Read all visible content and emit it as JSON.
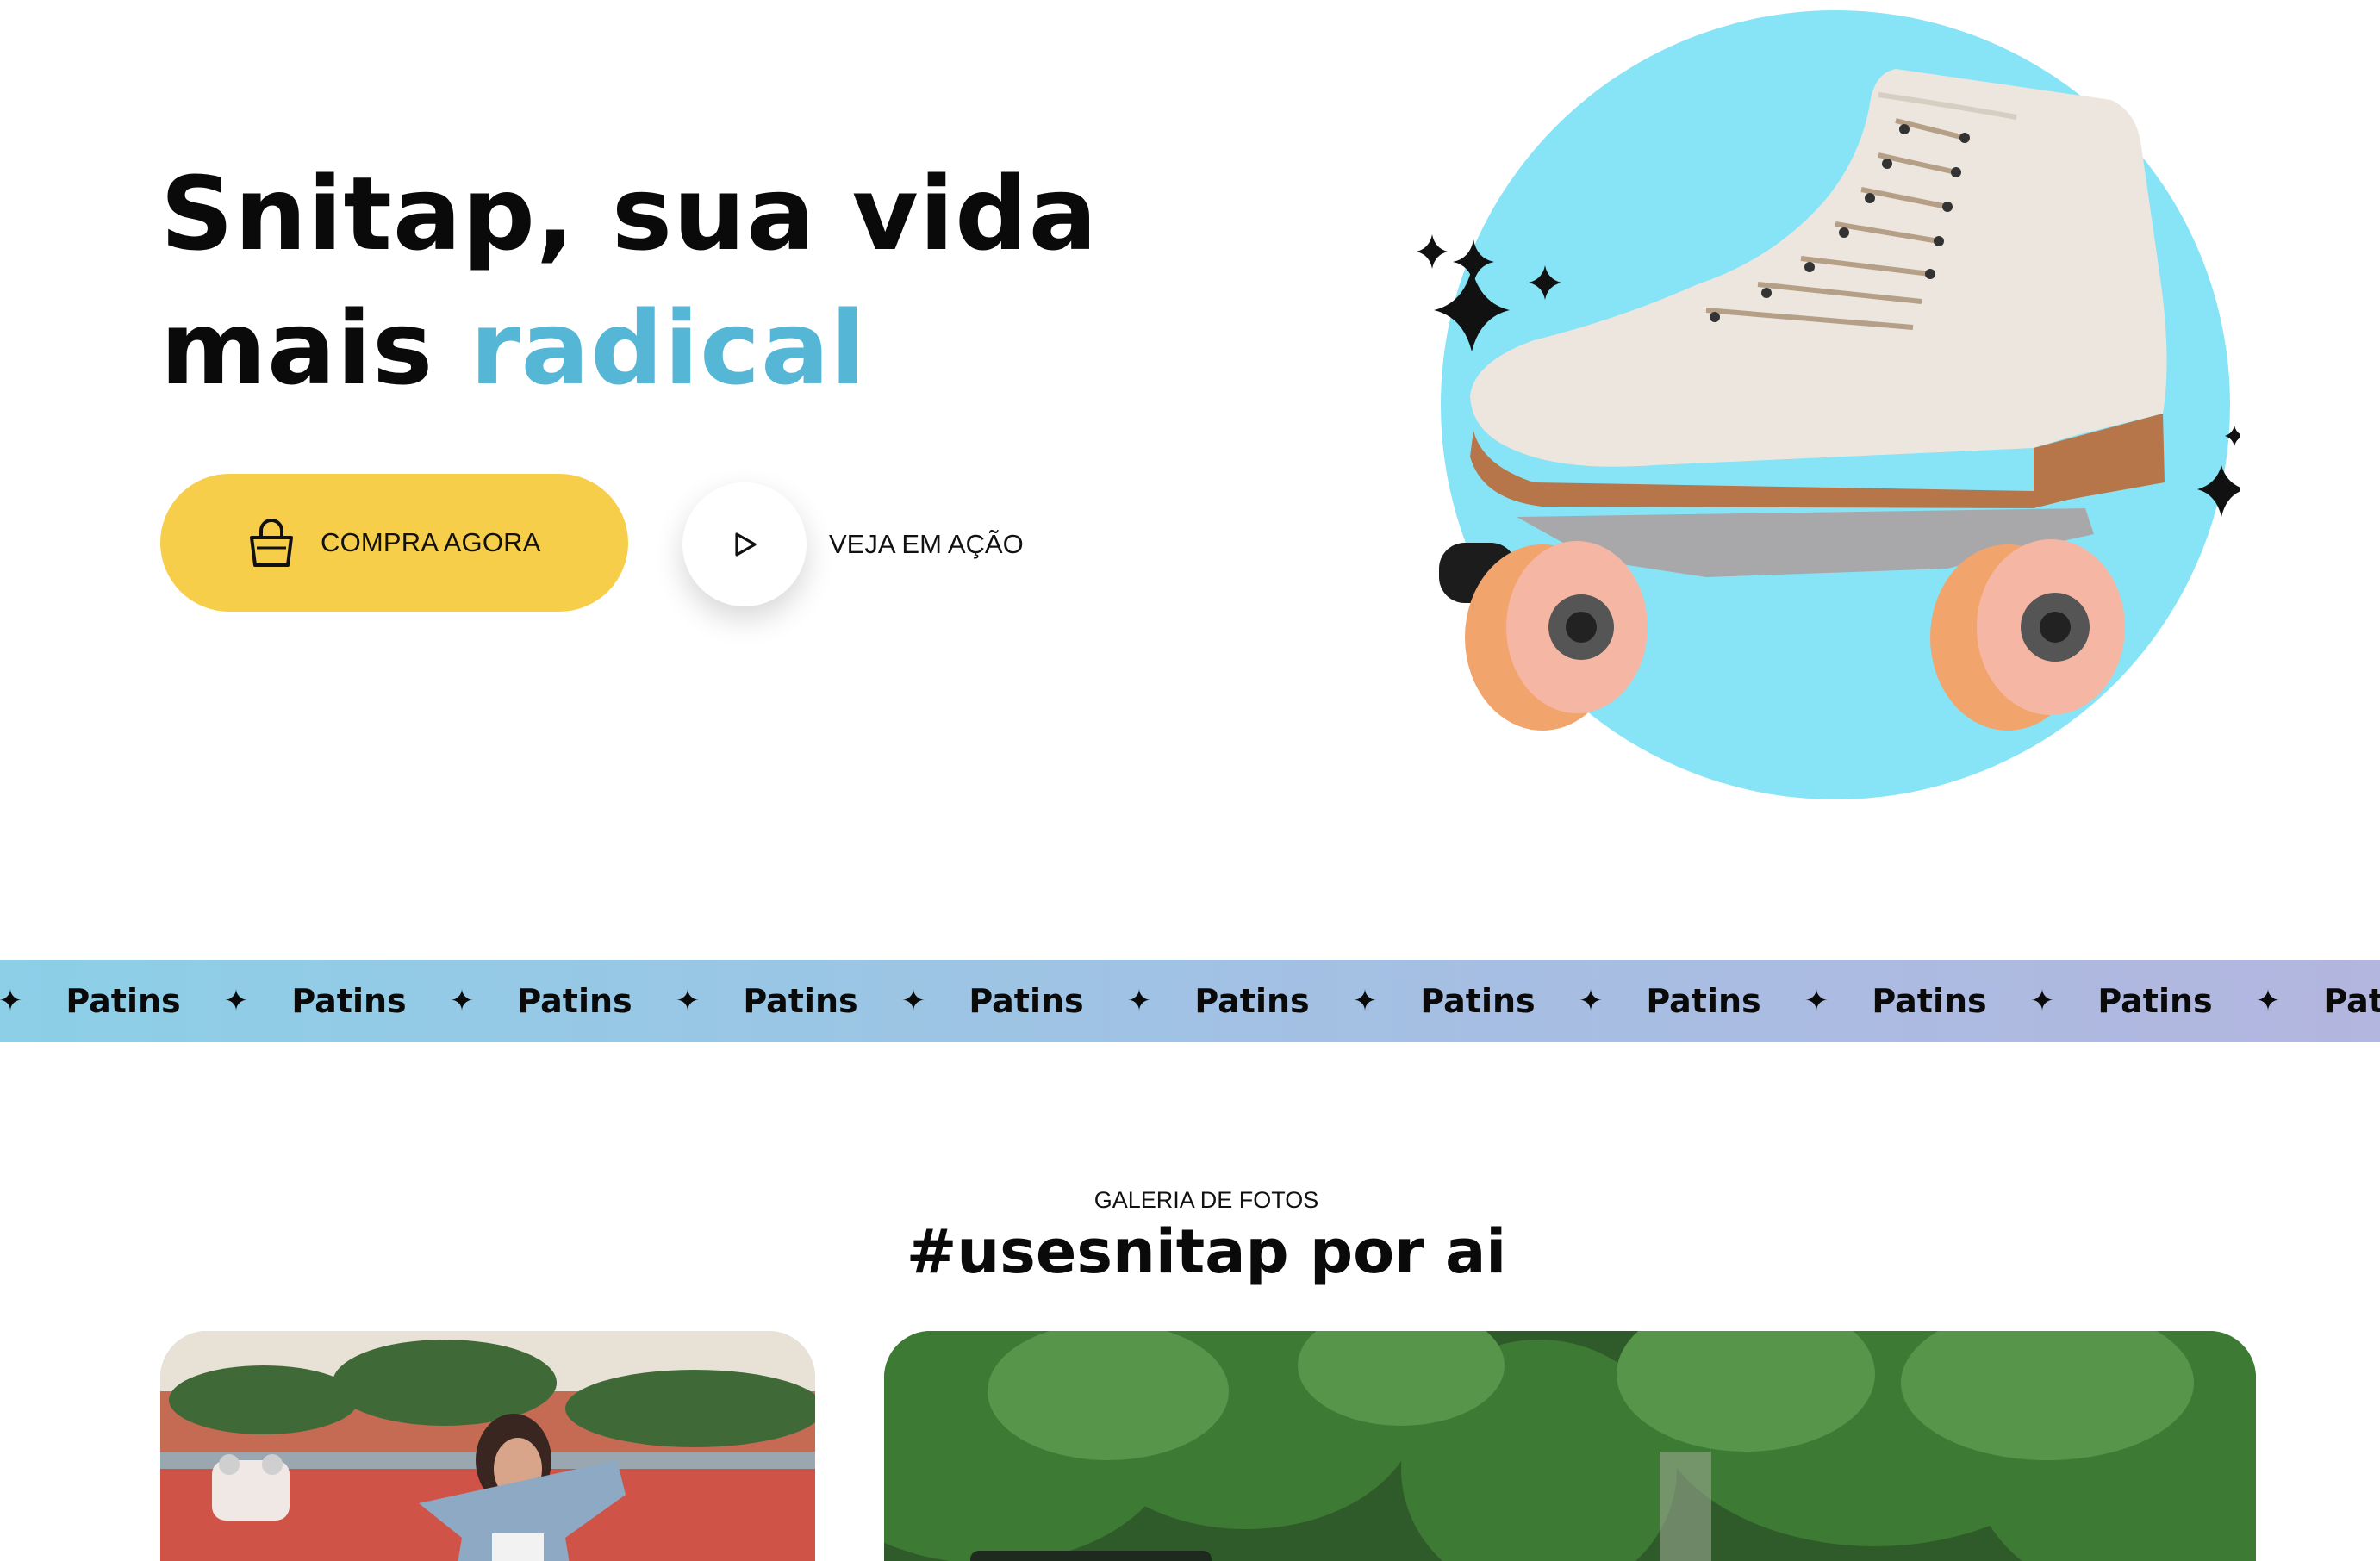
{
  "hero": {
    "title_line1": "Snitap, sua vida",
    "title_line2_prefix": "mais ",
    "title_line2_accent": "radical",
    "accent_color": "#55b6d6",
    "buy_button_label": "COMPRA AGORA",
    "buy_button_icon": "shopping-bag-icon",
    "buy_button_color": "#f7ce4a",
    "watch_button_label": "VEJA EM AÇÃO",
    "watch_button_icon": "play-icon"
  },
  "band": {
    "word": "Patins",
    "separator_icon": "sparkle-star-icon",
    "items": [
      "Patins",
      "Patins",
      "Patins",
      "Patins",
      "Patins",
      "Patins",
      "Patins",
      "Patins",
      "Patins",
      "Patins",
      "Patins"
    ]
  },
  "gallery": {
    "eyebrow": "GALERIA DE FOTOS",
    "title": "#usesnitap por ai"
  }
}
